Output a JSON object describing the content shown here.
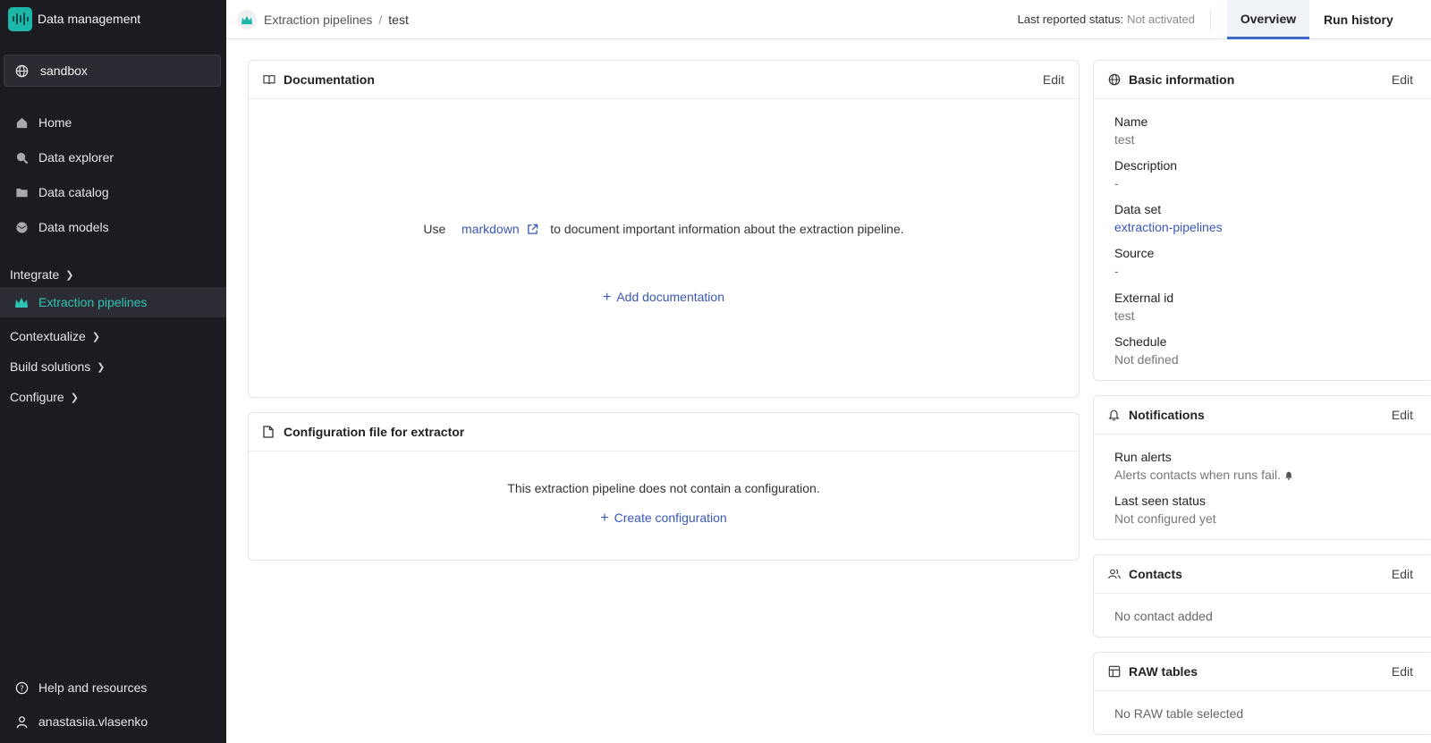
{
  "app": {
    "title": "Data management"
  },
  "project": {
    "name": "sandbox"
  },
  "nav": {
    "items": [
      {
        "label": "Home",
        "icon": "home-icon"
      },
      {
        "label": "Data explorer",
        "icon": "search-icon"
      },
      {
        "label": "Data catalog",
        "icon": "folder-icon"
      },
      {
        "label": "Data models",
        "icon": "cube-icon"
      }
    ],
    "integrate": "Integrate",
    "extraction": "Extraction pipelines",
    "contextualize": "Contextualize",
    "build": "Build solutions",
    "configure": "Configure",
    "help": "Help and resources",
    "user": "anastasiia.vlasenko"
  },
  "breadcrumb": {
    "parent": "Extraction pipelines",
    "current": "test"
  },
  "status": {
    "label": "Last reported status:",
    "value": "Not activated"
  },
  "tabs": {
    "overview": "Overview",
    "run_history": "Run history"
  },
  "documentation": {
    "title": "Documentation",
    "edit": "Edit",
    "text_before": "Use",
    "link": "markdown",
    "text_after": "to document important information about the extraction pipeline.",
    "add": "Add documentation"
  },
  "config": {
    "title": "Configuration file for extractor",
    "text": "This extraction pipeline does not contain a configuration.",
    "create": "Create configuration"
  },
  "basic": {
    "title": "Basic information",
    "edit": "Edit",
    "name_label": "Name",
    "name_value": "test",
    "desc_label": "Description",
    "desc_value": "-",
    "dataset_label": "Data set",
    "dataset_value": "extraction-pipelines",
    "source_label": "Source",
    "source_value": "-",
    "extid_label": "External id",
    "extid_value": "test",
    "schedule_label": "Schedule",
    "schedule_value": "Not defined"
  },
  "notifications": {
    "title": "Notifications",
    "edit": "Edit",
    "alerts_label": "Run alerts",
    "alerts_value": "Alerts contacts when runs fail.",
    "lastseen_label": "Last seen status",
    "lastseen_value": "Not configured yet"
  },
  "contacts": {
    "title": "Contacts",
    "edit": "Edit",
    "empty": "No contact added"
  },
  "raw": {
    "title": "RAW tables",
    "edit": "Edit",
    "empty": "No RAW table selected"
  },
  "colors": {
    "accent": "#2cc4b4",
    "link": "#3957b8",
    "sidebar": "#1b1c22",
    "tab_active": "#3d68c9"
  }
}
